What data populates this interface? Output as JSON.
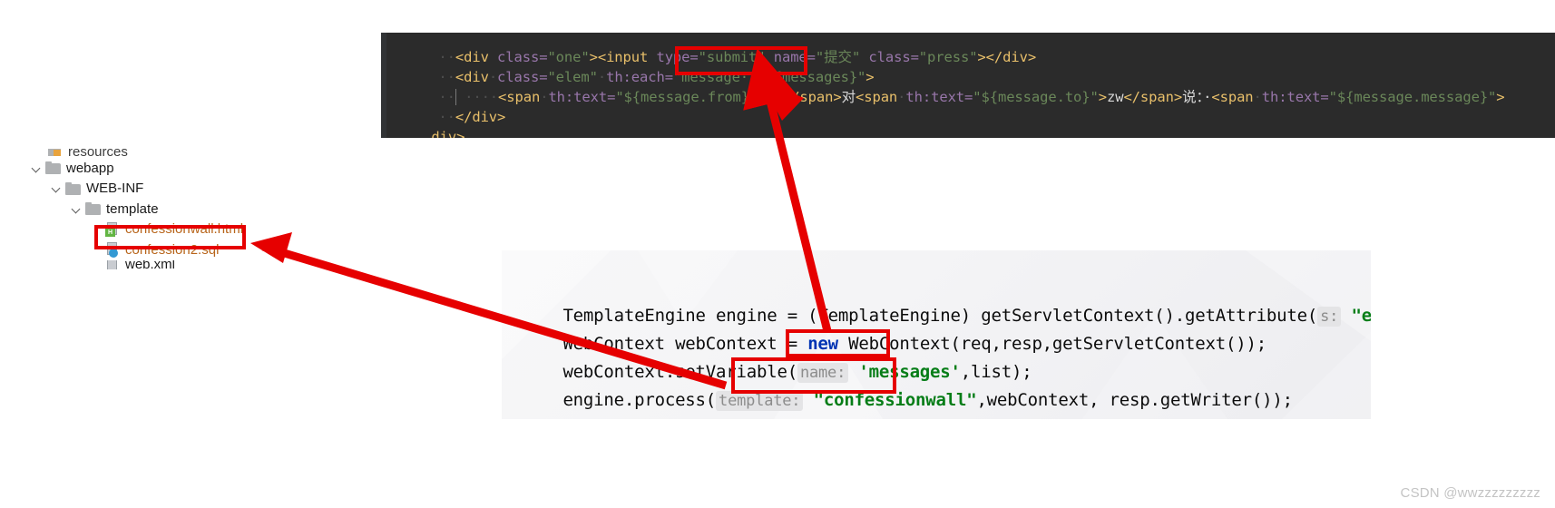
{
  "html_editor": {
    "lines": [
      {
        "id": "line-input-submit",
        "segments": [
          {
            "t": "··",
            "c": "dot"
          },
          {
            "t": "<div",
            "c": "tag"
          },
          {
            "t": " class=",
            "c": "attrn"
          },
          {
            "t": "\"one\"",
            "c": "str"
          },
          {
            "t": "><input",
            "c": "tag"
          },
          {
            "t": " type=",
            "c": "attrn"
          },
          {
            "t": "\"submit\"",
            "c": "str"
          },
          {
            "t": " name=",
            "c": "attrn"
          },
          {
            "t": "\"提交\"",
            "c": "str"
          },
          {
            "t": " class=",
            "c": "attrn"
          },
          {
            "t": "\"press\"",
            "c": "str"
          },
          {
            "t": "></div>",
            "c": "tag"
          }
        ]
      },
      {
        "id": "line-div-elem",
        "segments": [
          {
            "t": "··",
            "c": "dot"
          },
          {
            "t": "<div",
            "c": "tag"
          },
          {
            "t": "·",
            "c": "dot"
          },
          {
            "t": "class=",
            "c": "attrn"
          },
          {
            "t": "\"elem\"",
            "c": "str"
          },
          {
            "t": "·",
            "c": "dot"
          },
          {
            "t": "th:each=",
            "c": "attrn"
          },
          {
            "t": "\"message·:·${messages}\"",
            "c": "str"
          },
          {
            "t": ">",
            "c": "tag"
          }
        ]
      },
      {
        "id": "line-span-from",
        "segments": [
          {
            "t": "··|····",
            "c": "dot"
          },
          {
            "t": "<span",
            "c": "tag"
          },
          {
            "t": "·",
            "c": "dot"
          },
          {
            "t": "th:text=",
            "c": "attrn"
          },
          {
            "t": "\"${message.from}\"",
            "c": "str"
          },
          {
            "t": ">",
            "c": "tag"
          },
          {
            "t": "wz",
            "c": "white"
          },
          {
            "t": "</span>",
            "c": "tag"
          },
          {
            "t": "对",
            "c": "white"
          },
          {
            "t": "<span",
            "c": "tag"
          },
          {
            "t": "·",
            "c": "dot"
          },
          {
            "t": "th:text=",
            "c": "attrn"
          },
          {
            "t": "\"${message.to}\"",
            "c": "str"
          },
          {
            "t": ">",
            "c": "tag"
          },
          {
            "t": "zw",
            "c": "white"
          },
          {
            "t": "</span>",
            "c": "tag"
          },
          {
            "t": "说：·",
            "c": "white"
          },
          {
            "t": "<span",
            "c": "tag"
          },
          {
            "t": "·",
            "c": "dot"
          },
          {
            "t": "th:text=",
            "c": "attrn"
          },
          {
            "t": "\"${message.message}\"",
            "c": "str"
          },
          {
            "t": ">",
            "c": "tag"
          }
        ]
      },
      {
        "id": "line-close-div",
        "segments": [
          {
            "t": "··",
            "c": "dot"
          },
          {
            "t": "</div>",
            "c": "tag"
          }
        ]
      },
      {
        "id": "line-close-outer-div",
        "segments": [
          {
            "t": "div>",
            "c": "tag"
          }
        ]
      }
    ]
  },
  "file_tree": {
    "rows": [
      {
        "id": "resources",
        "label": "resources",
        "indent": 0,
        "icon": "resources-folder-icon",
        "chevron": false,
        "color": "dark",
        "clipped": true
      },
      {
        "id": "webapp",
        "label": "webapp",
        "indent": 0,
        "icon": "folder-icon",
        "chevron": true,
        "color": "dark",
        "clipped": false
      },
      {
        "id": "web-inf",
        "label": "WEB-INF",
        "indent": 1,
        "icon": "folder-icon",
        "chevron": true,
        "color": "dark",
        "clipped": false
      },
      {
        "id": "template",
        "label": "template",
        "indent": 2,
        "icon": "folder-icon",
        "chevron": true,
        "color": "dark",
        "clipped": false
      },
      {
        "id": "confessionwall-html",
        "label": "confessionwall.html",
        "indent": 3,
        "icon": "html-file-icon",
        "chevron": false,
        "color": "orange",
        "clipped": false
      },
      {
        "id": "confession2-sql",
        "label": "confession2.sql",
        "indent": 3,
        "icon": "sql-file-icon",
        "chevron": false,
        "color": "orange",
        "clipped": false
      },
      {
        "id": "web-xml",
        "label": "web.xml",
        "indent": 3,
        "icon": "xml-file-icon",
        "chevron": false,
        "color": "dark",
        "clipped": true
      }
    ]
  },
  "java_editor": {
    "lines": [
      {
        "id": "line-template-engine",
        "segments": [
          {
            "t": "TemplateEngine engine = (TemplateEngine) getServletContext().getAttribute(",
            "c": "plain"
          },
          {
            "t": "s:",
            "c": "hint"
          },
          {
            "t": " ",
            "c": "plain"
          },
          {
            "t": "\"engine\"",
            "c": "str"
          },
          {
            "t": ");",
            "c": "plain"
          }
        ]
      },
      {
        "id": "line-web-context",
        "segments": [
          {
            "t": "WebContext webContext = ",
            "c": "plain"
          },
          {
            "t": "new",
            "c": "kw"
          },
          {
            "t": " WebContext(req,resp,getServletContext());",
            "c": "plain"
          }
        ]
      },
      {
        "id": "line-set-variable",
        "segments": [
          {
            "t": "webContext.setVariable(",
            "c": "plain"
          },
          {
            "t": "name:",
            "c": "hint"
          },
          {
            "t": " ",
            "c": "plain"
          },
          {
            "t": "'messages'",
            "c": "str"
          },
          {
            "t": ",list);",
            "c": "plain"
          }
        ]
      },
      {
        "id": "line-engine-process",
        "segments": [
          {
            "t": "engine.process(",
            "c": "plain"
          },
          {
            "t": "template:",
            "c": "hint"
          },
          {
            "t": " ",
            "c": "plain"
          },
          {
            "t": "\"confessionwall\"",
            "c": "str"
          },
          {
            "t": ",webContext, resp.getWriter());",
            "c": "plain"
          }
        ]
      }
    ]
  },
  "annotations": {
    "accent_color": "#e60000",
    "boxes": [
      {
        "id": "box-messages-expr",
        "target": "${messages}"
      },
      {
        "id": "box-confessionwall",
        "target": "confessionwall.html"
      },
      {
        "id": "box-messages-var",
        "target": "'messages'"
      },
      {
        "id": "box-confession-str",
        "target": "\"confessionwall\""
      }
    ],
    "arrows": [
      {
        "id": "arrow-messages-to-expr",
        "from": "'messages' variable",
        "to": "${messages} expression"
      },
      {
        "id": "arrow-template-to-file",
        "from": "\"confessionwall\" template name",
        "to": "confessionwall.html file"
      }
    ]
  },
  "watermark": {
    "text": "CSDN @wwzzzzzzzzz"
  }
}
